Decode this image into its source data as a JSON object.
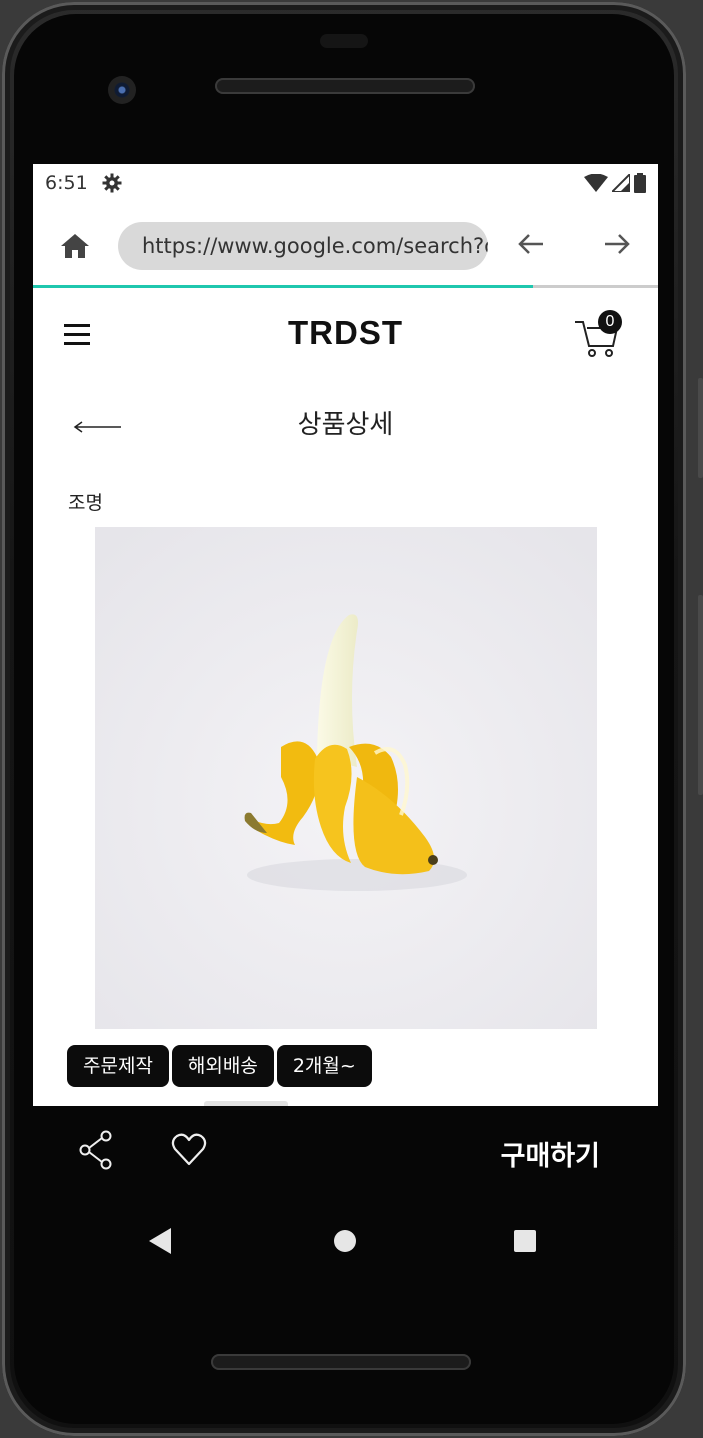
{
  "status": {
    "time": "6:51"
  },
  "browser": {
    "url": "https://www.google.com/search?q",
    "load_progress": 0.8
  },
  "app": {
    "logo": "TRDST",
    "cart_count": "0"
  },
  "page": {
    "title": "상품상세",
    "category": "조명",
    "tags": [
      "주문제작",
      "해외배송",
      "2개월~"
    ]
  },
  "actions": {
    "buy_label": "구매하기"
  },
  "colors": {
    "accent": "#1fc7ae",
    "banana": "#f3c21a"
  },
  "icons": [
    "gear-icon",
    "wifi-icon",
    "signal-icon",
    "battery-icon",
    "home-icon",
    "back-arrow-icon",
    "forward-arrow-icon",
    "menu-icon",
    "cart-icon",
    "share-icon",
    "heart-icon"
  ]
}
